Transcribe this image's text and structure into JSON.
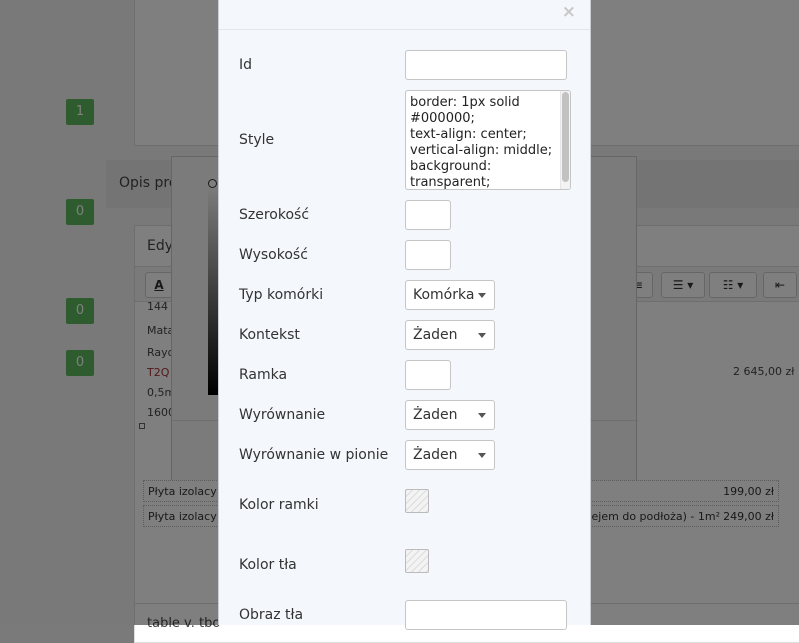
{
  "background": {
    "badges": [
      "1",
      "0",
      "0",
      "0"
    ],
    "section_title": "Opis pro",
    "editor_title": "Edy",
    "toolbar_letter": "A",
    "editor_lines": [
      "144",
      "Mata",
      "Rayo",
      "T2Q",
      "0,5m",
      "1600"
    ],
    "cell_price": "2 645,00 zł",
    "cell_symbol": "ł",
    "rows": [
      {
        "left": "Płyta izolacy",
        "middle": "",
        "right": "199,00 zł"
      },
      {
        "left": "Płyta izolacy",
        "middle": "ejem do podłoża) - 1m²",
        "right": "249,00 zł"
      }
    ],
    "bottom_text": "table v. tbo"
  },
  "modal": {
    "close_symbol": "×",
    "fields": {
      "id": {
        "label": "Id",
        "value": ""
      },
      "style": {
        "label": "Style",
        "value": "border: 1px solid #000000;\ntext-align: center;\nvertical-align: middle;\nbackground: transparent;"
      },
      "width": {
        "label": "Szerokość",
        "value": ""
      },
      "height": {
        "label": "Wysokość",
        "value": ""
      },
      "cell_type": {
        "label": "Typ komórki",
        "value": "Komórka"
      },
      "context": {
        "label": "Kontekst",
        "value": "Żaden"
      },
      "border": {
        "label": "Ramka",
        "value": ""
      },
      "align": {
        "label": "Wyrównanie",
        "value": "Żaden"
      },
      "valign": {
        "label": "Wyrównanie w pionie",
        "value": "Żaden"
      },
      "border_color": {
        "label": "Kolor ramki"
      },
      "bg_color": {
        "label": "Kolor tła"
      },
      "bg_image": {
        "label": "Obraz tła",
        "value": ""
      }
    }
  },
  "colors": {
    "badge": "#5cb85c",
    "modal_bg": "#f4f7fb"
  }
}
